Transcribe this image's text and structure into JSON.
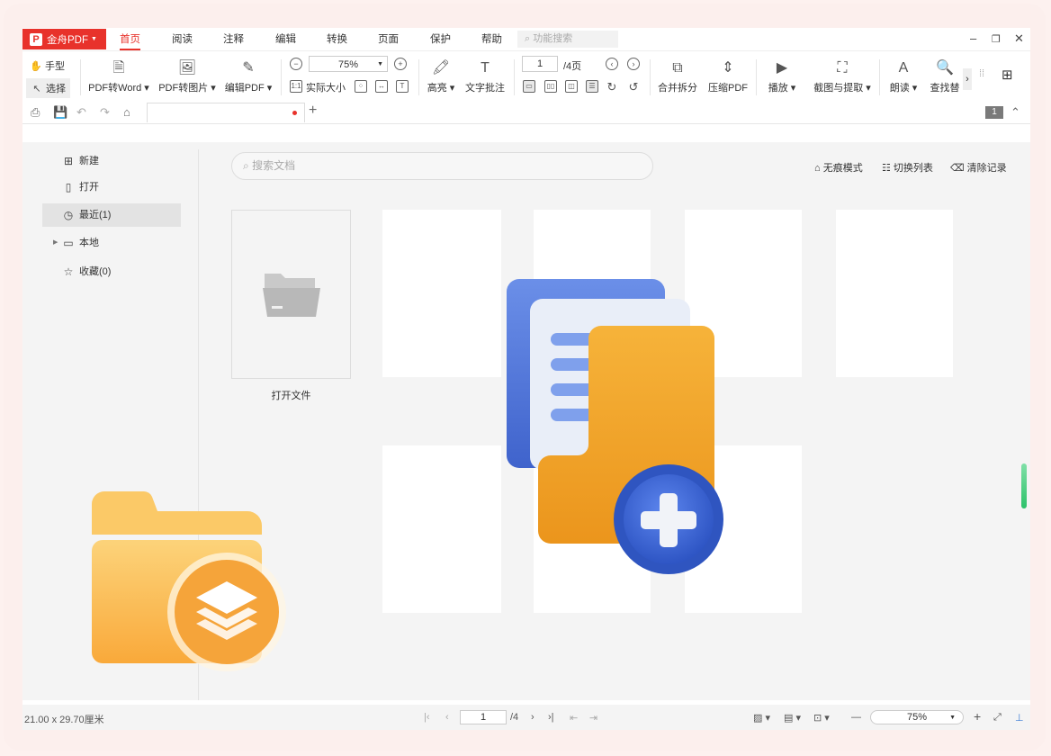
{
  "app": {
    "brand": "金舟PDF"
  },
  "menu": [
    "首页",
    "阅读",
    "注释",
    "编辑",
    "转换",
    "页面",
    "保护",
    "帮助"
  ],
  "function_search": {
    "placeholder": "功能搜索"
  },
  "toolbar": {
    "hand": "手型",
    "select": "选择",
    "pdf_to_word": "PDF转Word",
    "pdf_to_image": "PDF转图片",
    "edit_pdf": "编辑PDF",
    "zoom": "75%",
    "actual_size": "实际大小",
    "highlight": "高亮",
    "text_note": "文字批注",
    "page_current": "1",
    "page_total": "/4页",
    "merge_split": "合并拆分",
    "compress": "压缩PDF",
    "play": "播放",
    "screenshot_extract": "截图与提取",
    "read_aloud": "朗读",
    "find_replace": "查找替"
  },
  "quickbar": {
    "page_badge": "1"
  },
  "sidebar": {
    "items": [
      {
        "label": "新建",
        "icon": "new-file-icon"
      },
      {
        "label": "打开",
        "icon": "file-icon"
      },
      {
        "label": "最近(1)",
        "icon": "clock-icon"
      },
      {
        "label": "本地",
        "icon": "computer-icon"
      },
      {
        "label": "收藏(0)",
        "icon": "star-icon"
      }
    ]
  },
  "main": {
    "search_placeholder": "搜索文档",
    "incognito": "无痕模式",
    "switch_list": "切换列表",
    "clear_records": "清除记录",
    "open_file": "打开文件"
  },
  "status": {
    "page_size": "21.00 x 29.70厘米",
    "page_current": "1",
    "page_total": "/4",
    "zoom": "75%"
  },
  "colors": {
    "brand": "#e8322b",
    "content_bg": "#f4f4f4",
    "folder_orange": "#f3a62a",
    "doc_blue": "#4f73d6"
  }
}
